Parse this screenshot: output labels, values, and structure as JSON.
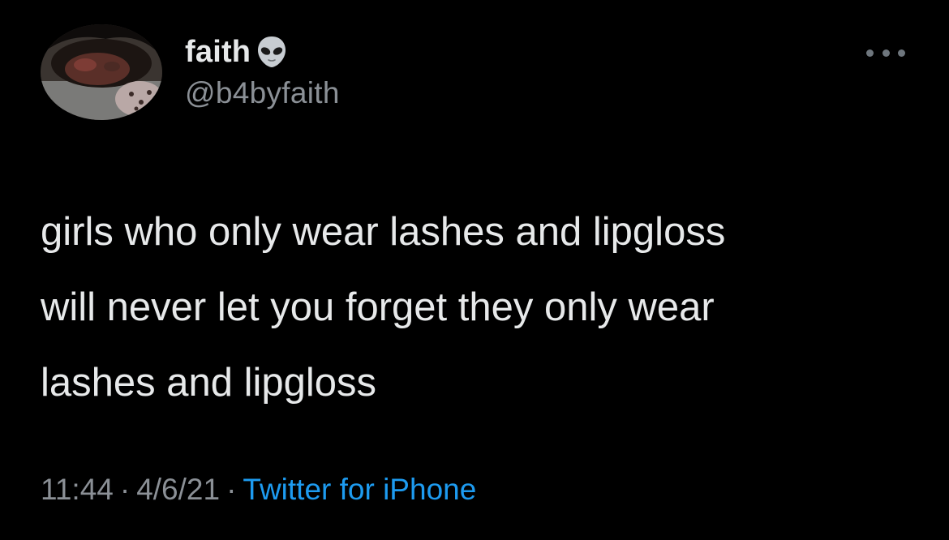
{
  "author": {
    "display_name": "faith",
    "name_emoji": "alien-icon",
    "handle": "@b4byfaith"
  },
  "tweet": {
    "lines": [
      "girls who only wear lashes and lipgloss",
      "will never let you forget they only wear",
      "lashes and lipgloss"
    ]
  },
  "meta": {
    "time": "11:44",
    "separator": "·",
    "date": "4/6/21",
    "source": "Twitter for iPhone"
  },
  "icons": {
    "more": "more-options-icon",
    "avatar": "avatar"
  },
  "colors": {
    "background": "#000000",
    "text": "#E7E9EA",
    "secondary": "#8B9096",
    "link": "#1D9BF0"
  }
}
